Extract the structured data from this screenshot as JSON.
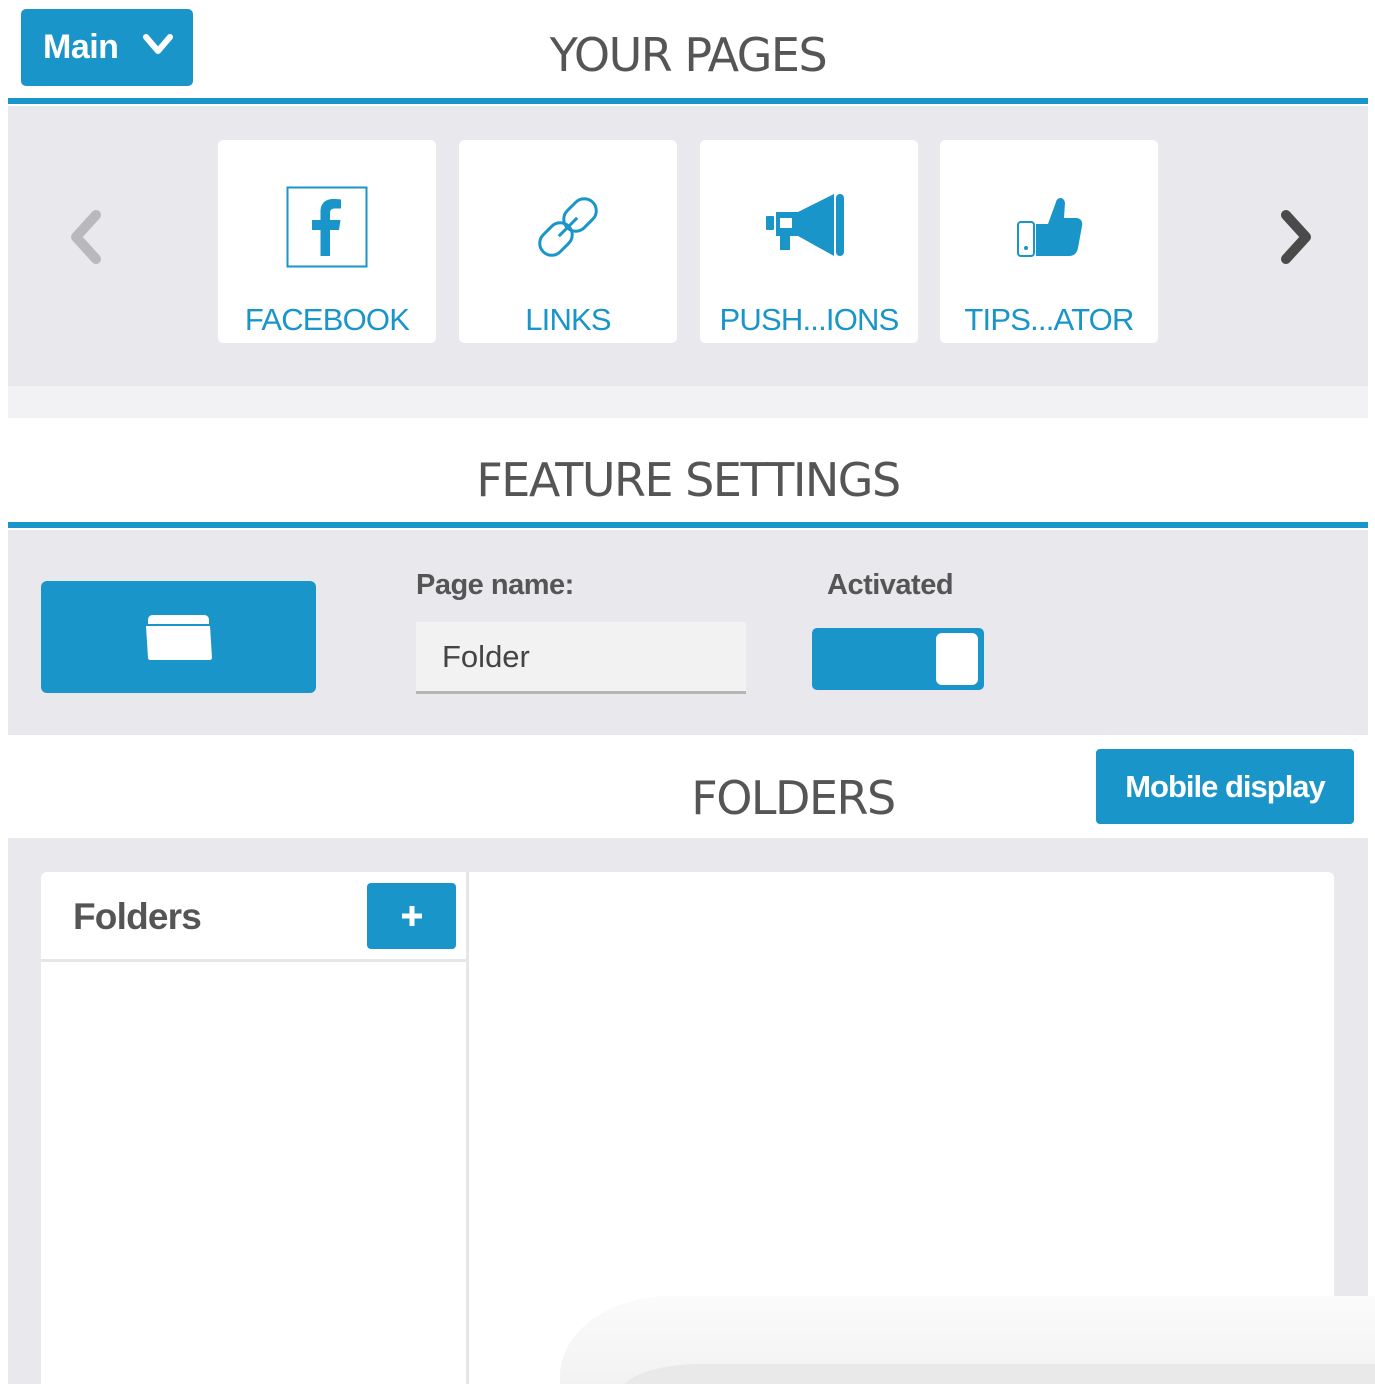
{
  "header": {
    "dropdown_label": "Main",
    "title": "YOUR PAGES"
  },
  "pages": [
    {
      "label": "FACEBOOK",
      "icon": "facebook-icon"
    },
    {
      "label": "LINKS",
      "icon": "link-icon"
    },
    {
      "label": "PUSH...IONS",
      "icon": "megaphone-icon"
    },
    {
      "label": "TIPS...ATOR",
      "icon": "thumbs-up-icon"
    }
  ],
  "feature_settings": {
    "title": "FEATURE SETTINGS",
    "page_name_label": "Page name:",
    "page_name_value": "Folder",
    "activated_label": "Activated",
    "activated": true,
    "icon": "folder-icon"
  },
  "folders": {
    "title": "FOLDERS",
    "mobile_display_label": "Mobile display",
    "list_title": "Folders",
    "add_label": "+"
  },
  "colors": {
    "accent": "#1a95ca",
    "band": "#e8e8ed",
    "heading": "#555555"
  }
}
